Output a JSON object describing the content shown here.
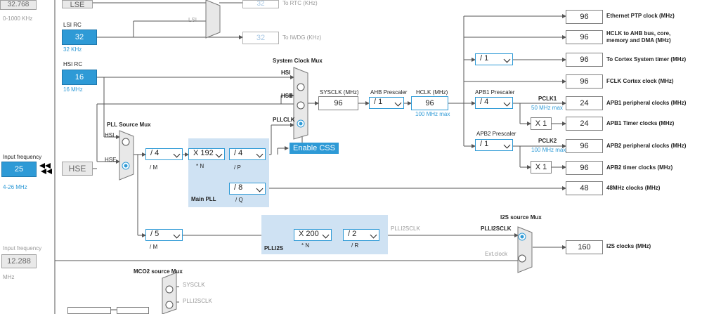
{
  "left": {
    "lse_value": "32.768",
    "lse_range": "0-1000 KHz",
    "lse_label": "LSE",
    "lsi_rc_label": "LSI RC",
    "lsi_value": "32",
    "lsi_freq": "32 KHz",
    "hsi_rc_label": "HSI RC",
    "hsi_value": "16",
    "hsi_freq": "16 MHz",
    "input_freq_label": "Input frequency",
    "input_freq_value": "25",
    "input_freq_range": "4-26 MHz",
    "hse_label": "HSE",
    "input_freq2_label": "Input frequency",
    "input_freq2_value": "12.288",
    "input_freq2_unit": "MHz"
  },
  "rtc": {
    "lse_tag": "LSE",
    "lsi_tag": "LSI",
    "rtc_value": "32",
    "rtc_label": "To RTC (KHz)",
    "iwdg_value": "32",
    "iwdg_label": "To IWDG (KHz)"
  },
  "pll": {
    "source_mux_label": "PLL Source Mux",
    "hsi_tag": "HSI",
    "hse_tag": "HSE",
    "m_value": "/ 4",
    "m_label": "/ M",
    "n_value": "X 192",
    "n_label": "* N",
    "p_value": "/ 4",
    "p_label": "/ P",
    "q_value": "/ 8",
    "q_label": "/ Q",
    "main_pll_label": "Main PLL"
  },
  "sysclk": {
    "mux_label": "System Clock Mux",
    "hsi_tag": "HSI",
    "hse_tag": "HSE",
    "pllclk_tag": "PLLCLK",
    "enable_css": "Enable CSS",
    "sysclk_label": "SYSCLK (MHz)",
    "sysclk_value": "96",
    "ahb_label": "AHB Prescaler",
    "ahb_value": "/ 1",
    "hclk_label": "HCLK (MHz)",
    "hclk_value": "96",
    "hclk_max": "100 MHz max"
  },
  "apb": {
    "apb1_label": "APB1 Prescaler",
    "apb1_value": "/ 4",
    "pclk1_label": "PCLK1",
    "pclk1_max": "50 MHz max",
    "apb1_timer_mult": "X 1",
    "apb2_label": "APB2 Prescaler",
    "apb2_value": "/ 1",
    "pclk2_label": "PCLK2",
    "pclk2_max": "100 MHz max",
    "apb2_timer_mult": "X 1",
    "cortex_div": "/ 1"
  },
  "outputs": [
    {
      "value": "96",
      "label": "Ethernet PTP clock (MHz)"
    },
    {
      "value": "96",
      "label": "HCLK to AHB bus, core,",
      "label2": "memory and DMA (MHz)"
    },
    {
      "value": "96",
      "label": "To Cortex System timer (MHz)"
    },
    {
      "value": "96",
      "label": "FCLK Cortex clock (MHz)"
    },
    {
      "value": "24",
      "label": "APB1 peripheral clocks (MHz)"
    },
    {
      "value": "24",
      "label": "APB1 Timer clocks (MHz)"
    },
    {
      "value": "96",
      "label": "APB2 peripheral clocks (MHz)"
    },
    {
      "value": "96",
      "label": "APB2 timer clocks (MHz)"
    },
    {
      "value": "48",
      "label": "48MHz clocks (MHz)"
    },
    {
      "value": "160",
      "label": "I2S clocks (MHz)"
    }
  ],
  "plli2s": {
    "m_value": "/ 5",
    "m_label": "/ M",
    "n_value": "X 200",
    "n_label": "* N",
    "r_value": "/ 2",
    "r_label": "/ R",
    "panel_label": "PLLI2S",
    "plli2sclk_tag": "PLLI2SCLK",
    "i2s_mux_label": "I2S source Mux",
    "plli2sclk_sel": "PLLI2SCLK",
    "ext_clock": "Ext.clock"
  },
  "mco2": {
    "mux_label": "MCO2 source Mux",
    "sysclk_tag": "SYSCLK",
    "plli2sclk_tag": "PLLI2SCLK"
  },
  "colors": {
    "accent": "#2e9ad6",
    "panel": "#cfe2f3",
    "line": "#555555"
  }
}
